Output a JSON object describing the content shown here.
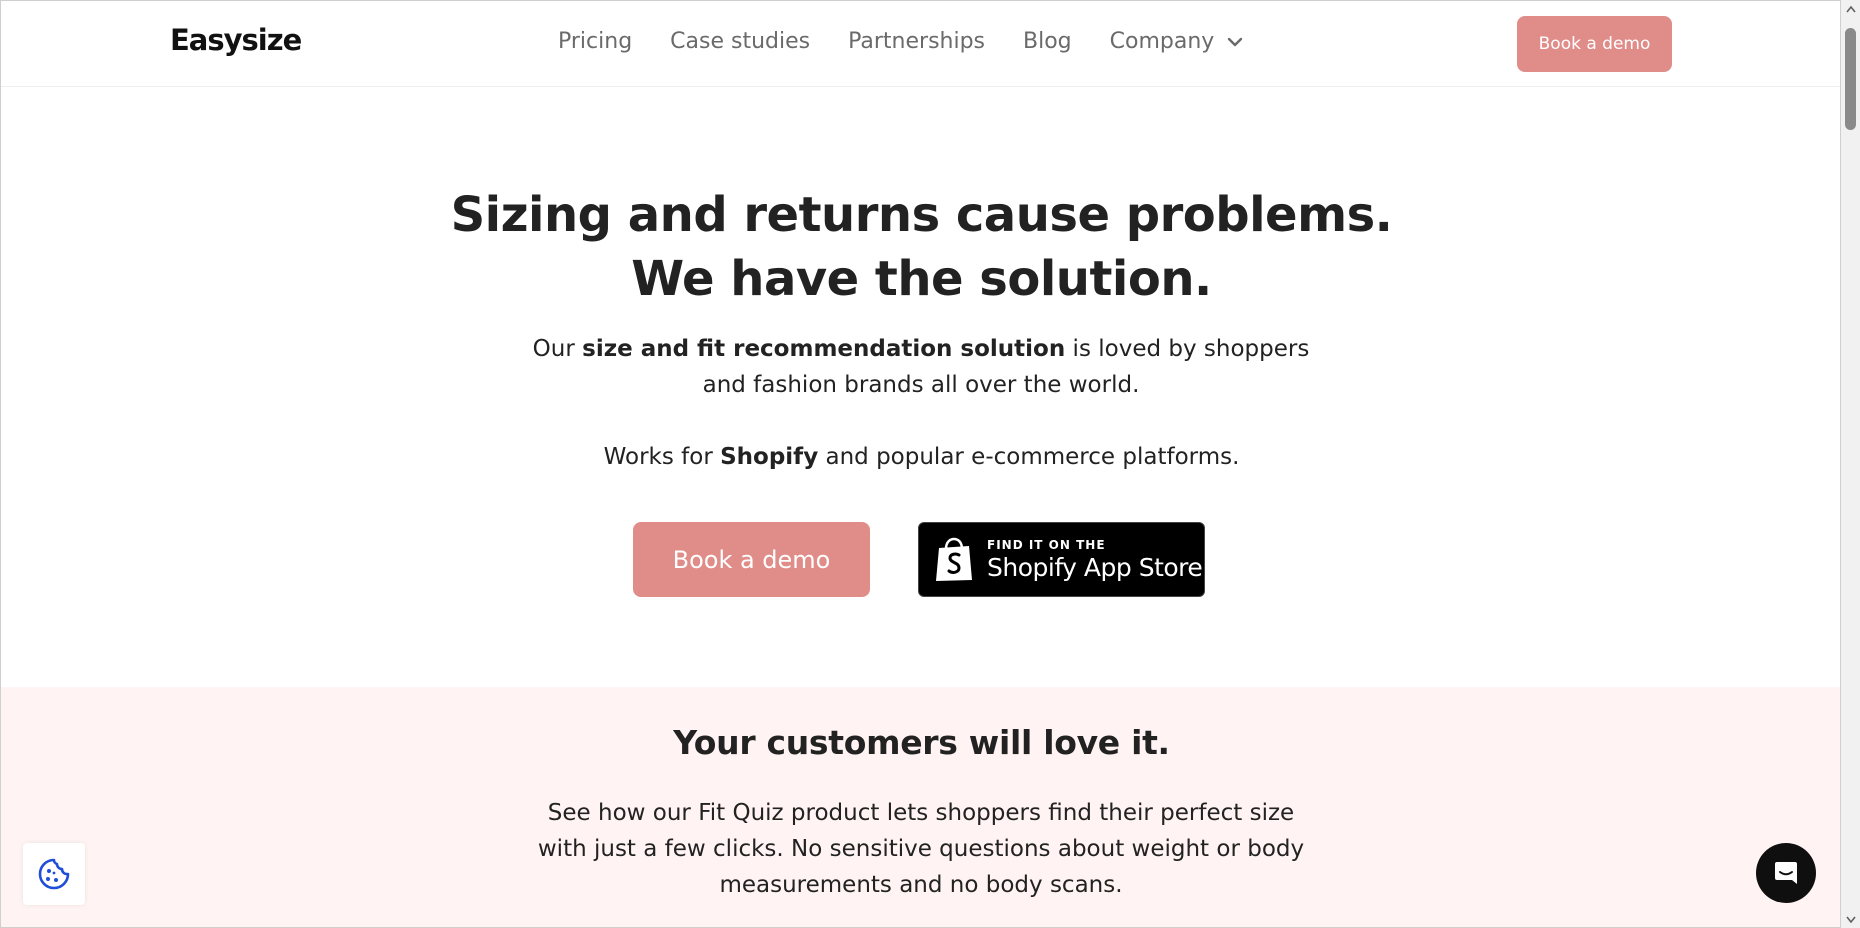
{
  "header": {
    "logo": "Easysize",
    "nav": [
      "Pricing",
      "Case studies",
      "Partnerships",
      "Blog"
    ],
    "company_label": "Company",
    "cta_label": "Book a demo"
  },
  "hero": {
    "title_line1": "Sizing and returns cause problems.",
    "title_line2": "We have the solution.",
    "sub_prefix": "Our ",
    "sub_bold": "size and fit recommendation solution",
    "sub_suffix": " is loved by shoppers and fashion brands all over the world.",
    "platform_prefix": "Works for ",
    "platform_bold": "Shopify",
    "platform_suffix": " and popular e-commerce platforms.",
    "demo_button": "Book a demo",
    "shopify_badge_small": "FIND IT ON THE",
    "shopify_badge_big": "Shopify App Store"
  },
  "section_love": {
    "title": "Your customers will love it.",
    "body": "See how our Fit Quiz product lets shoppers find their perfect size with just a few clicks. No sensitive questions about weight or body measurements and no body scans."
  },
  "icons": {
    "cookie": "cookie-icon",
    "chat": "chat-icon",
    "dropdown": "chevron-down-icon",
    "shopify": "shopify-bag-icon"
  },
  "colors": {
    "accent": "#e08c88",
    "section_bg": "#fff4f3",
    "text": "#222222",
    "nav_text": "#6a6a6a"
  }
}
